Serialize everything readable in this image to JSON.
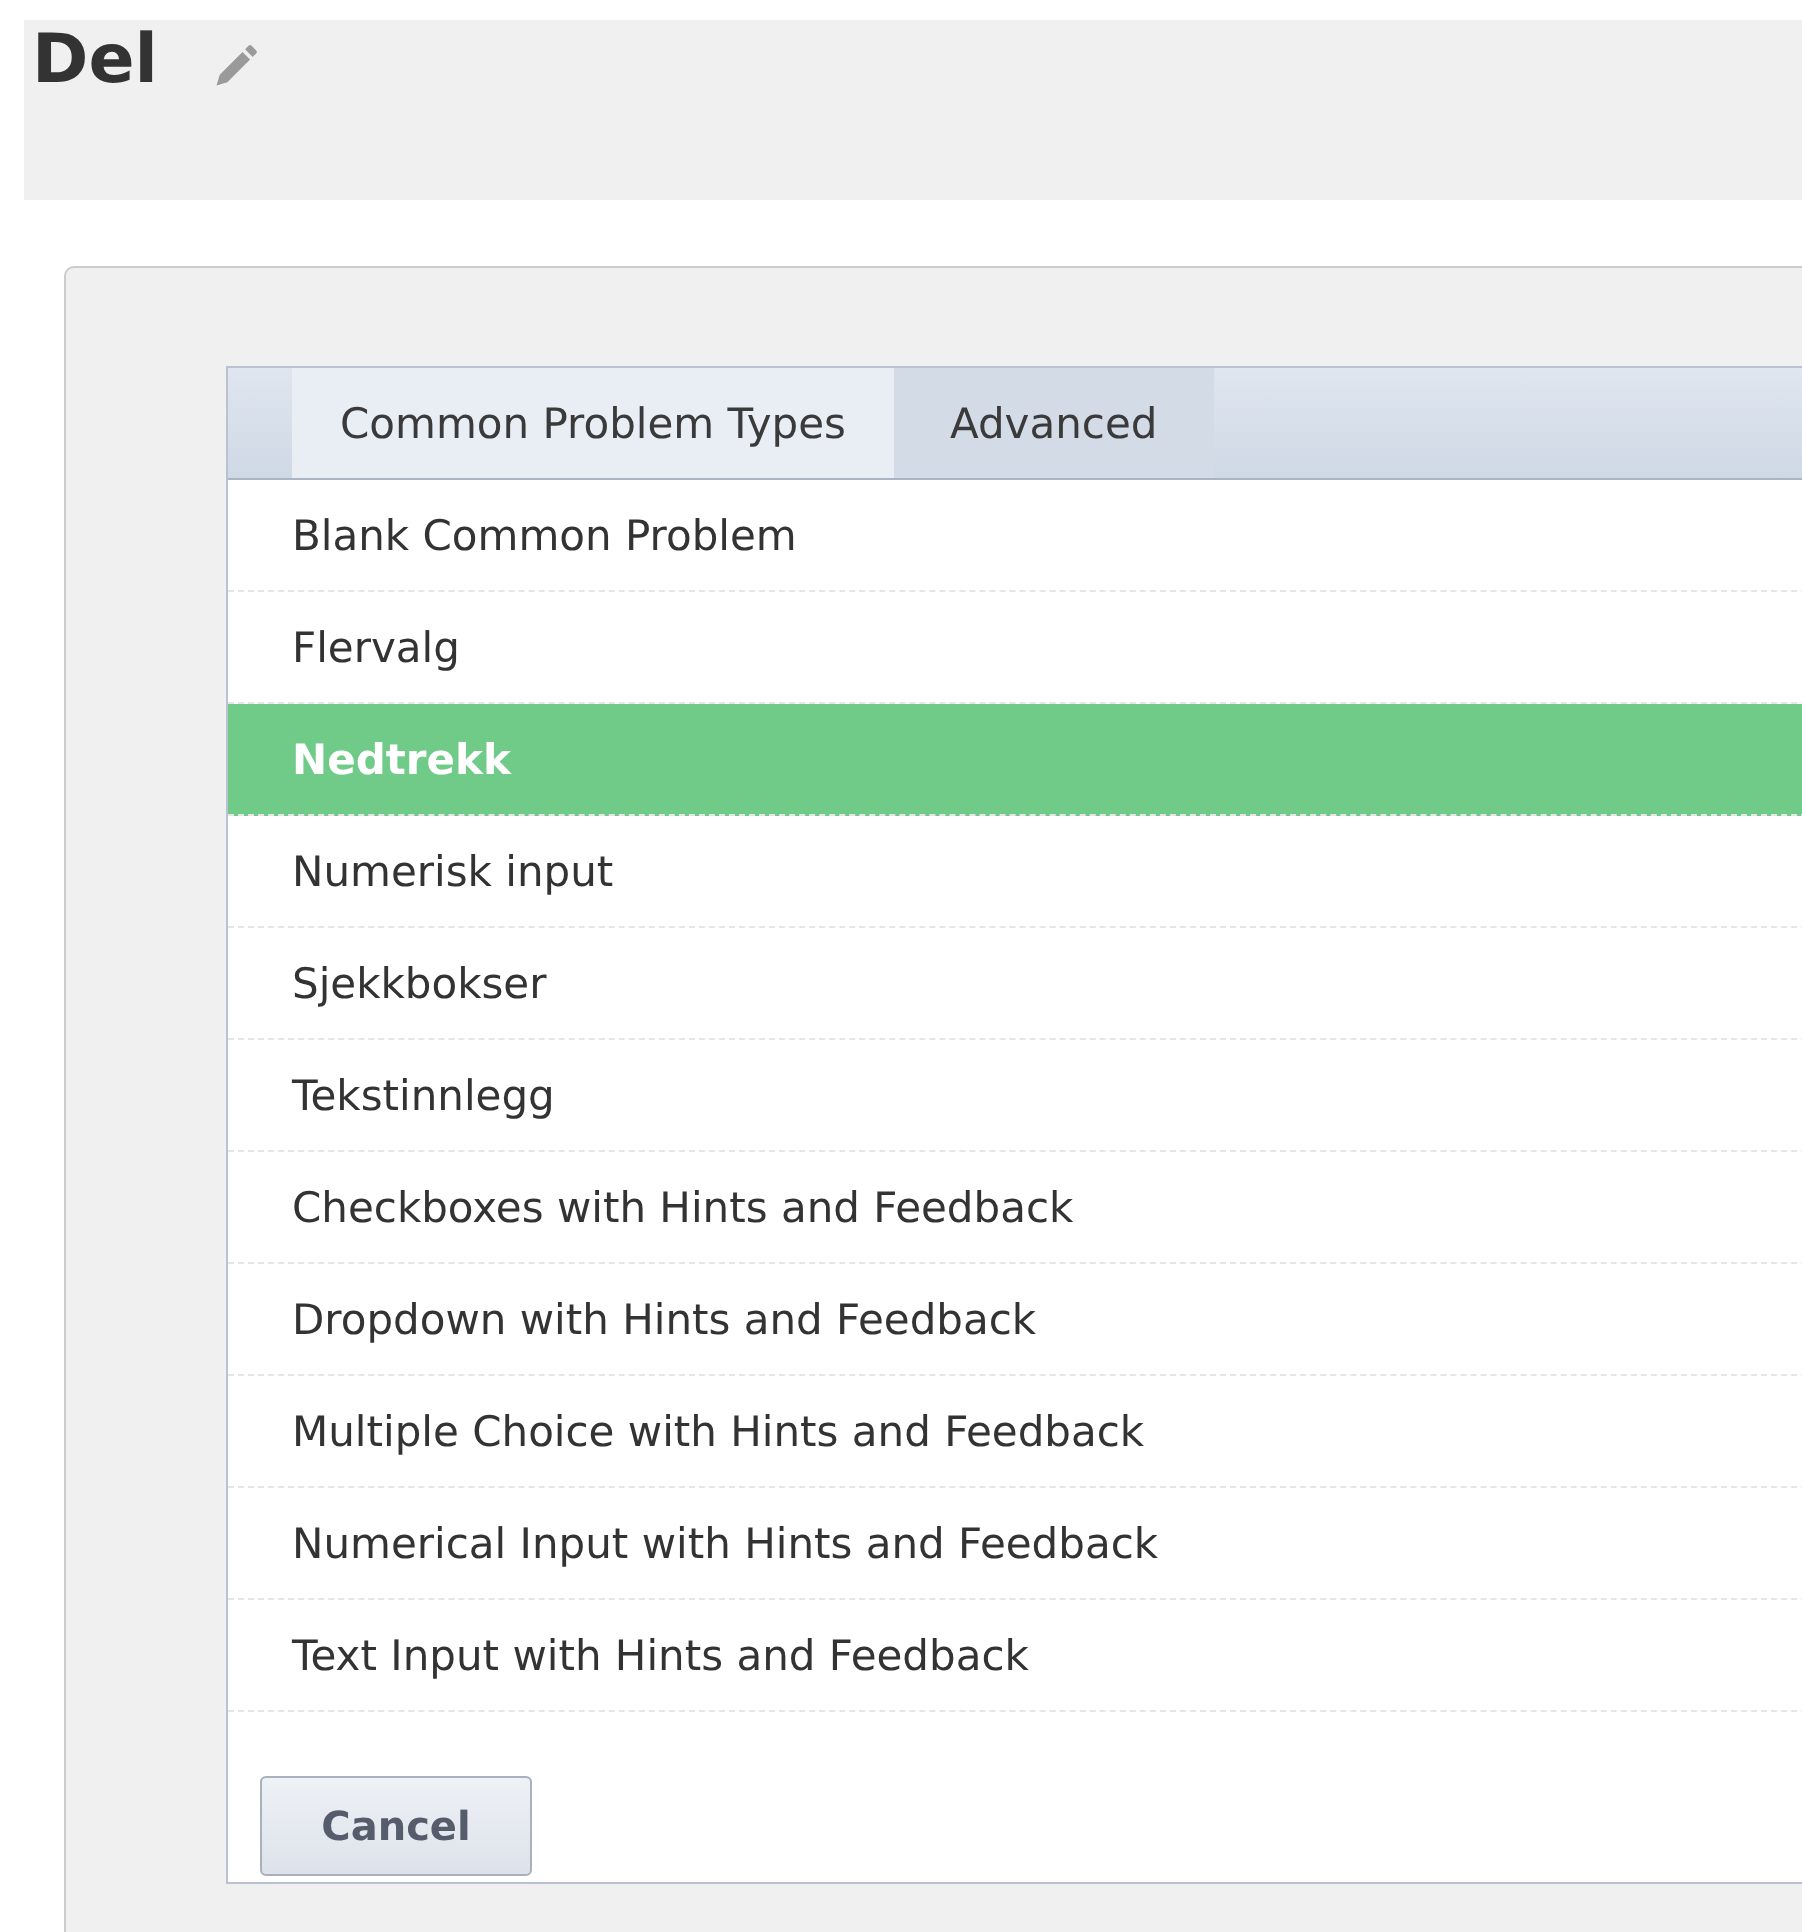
{
  "heading": {
    "title": "Del"
  },
  "tabs": [
    {
      "label": "Common Problem Types",
      "selected": true
    },
    {
      "label": "Advanced",
      "selected": false
    }
  ],
  "items": [
    {
      "label": "Blank Common Problem",
      "selected": false
    },
    {
      "label": "Flervalg",
      "selected": false
    },
    {
      "label": "Nedtrekk",
      "selected": true
    },
    {
      "label": "Numerisk input",
      "selected": false
    },
    {
      "label": "Sjekkbokser",
      "selected": false
    },
    {
      "label": "Tekstinnlegg",
      "selected": false
    },
    {
      "label": "Checkboxes with Hints and Feedback",
      "selected": false
    },
    {
      "label": "Dropdown with Hints and Feedback",
      "selected": false
    },
    {
      "label": "Multiple Choice with Hints and Feedback",
      "selected": false
    },
    {
      "label": "Numerical Input with Hints and Feedback",
      "selected": false
    },
    {
      "label": "Text Input with Hints and Feedback",
      "selected": false
    }
  ],
  "buttons": [
    "Cancel"
  ]
}
